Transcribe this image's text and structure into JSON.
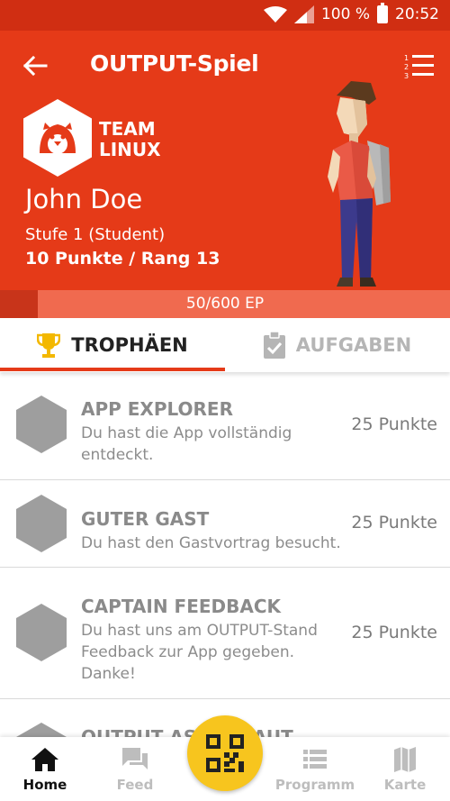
{
  "status_bar": {
    "battery": "100 %",
    "time": "20:52"
  },
  "header": {
    "title": "OUTPUT-Spiel",
    "team_name_line1": "TEAM",
    "team_name_line2": "LINUX",
    "user_name": "John Doe",
    "level": "Stufe 1 (Student)",
    "points_rank": "10 Punkte / Rang 13"
  },
  "progress": {
    "label": "50/600 EP",
    "current": 50,
    "max": 600
  },
  "tabs": [
    {
      "label": "TROPHÄEN",
      "icon": "trophy-icon",
      "active": true
    },
    {
      "label": "AUFGABEN",
      "icon": "clipboard-check-icon",
      "active": false
    }
  ],
  "trophies": [
    {
      "title": "APP EXPLORER",
      "description": "Du hast die App vollständig entdeckt.",
      "points": "25 Punkte"
    },
    {
      "title": "GUTER GAST",
      "description": "Du hast den Gastvortrag besucht.",
      "points": "25 Punkte"
    },
    {
      "title": "CAPTAIN FEEDBACK",
      "description": "Du hast uns am OUTPUT-Stand Feedback zur App gegeben. Danke!",
      "points": "25 Punkte"
    },
    {
      "title": "OUTPUT ASTRONAUT",
      "description": "",
      "points": ""
    }
  ],
  "bottom_nav": [
    {
      "label": "Home",
      "icon": "home-icon",
      "active": true
    },
    {
      "label": "Feed",
      "icon": "chat-icon",
      "active": false
    },
    {
      "label": "Programm",
      "icon": "list-icon",
      "active": false
    },
    {
      "label": "Karte",
      "icon": "map-icon",
      "active": false
    }
  ],
  "colors": {
    "accent": "#e53a18",
    "status_bar": "#d02e12",
    "progress_track": "#f06a4f",
    "progress_fill": "#c8341a",
    "qr_button": "#f7c51e",
    "trophy_gold": "#f3b800",
    "hex_inactive": "#9e9e9e"
  }
}
